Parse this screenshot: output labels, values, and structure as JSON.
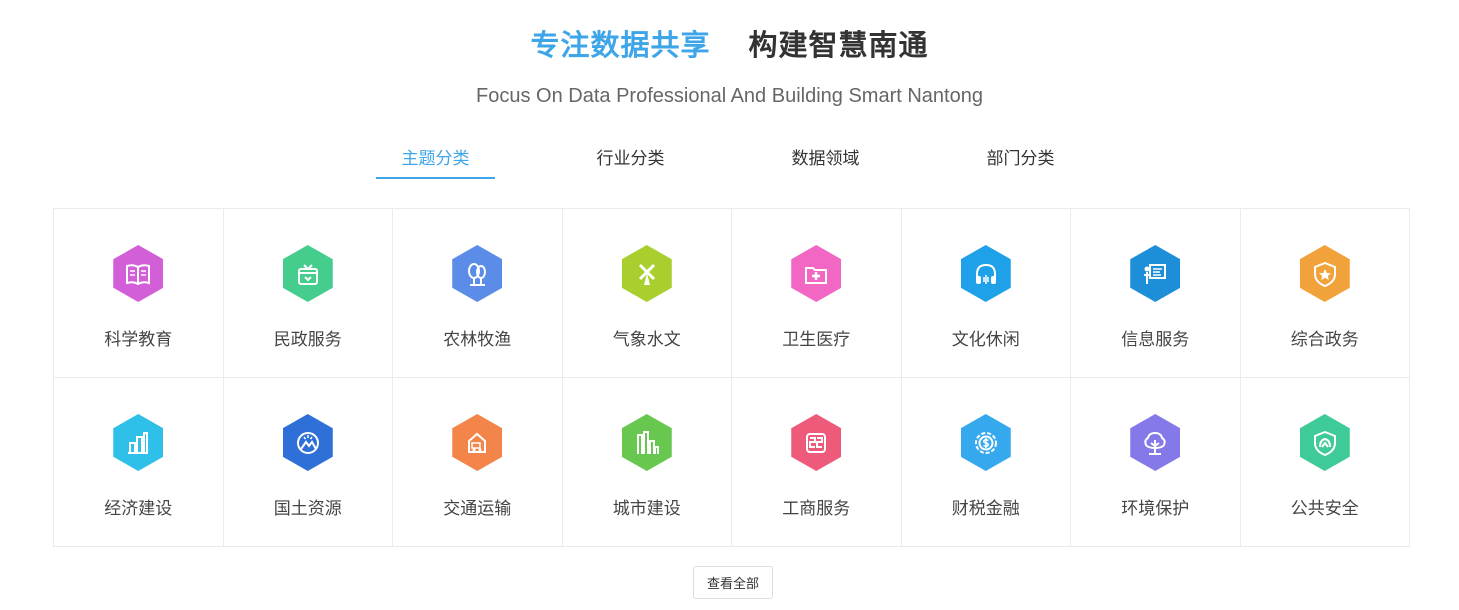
{
  "header": {
    "title_part1": "专注数据共享",
    "title_part2": "构建智慧南通",
    "subtitle": "Focus On Data Professional And Building Smart Nantong"
  },
  "tabs": [
    {
      "label": "主题分类",
      "active": true
    },
    {
      "label": "行业分类",
      "active": false
    },
    {
      "label": "数据领域",
      "active": false
    },
    {
      "label": "部门分类",
      "active": false
    }
  ],
  "categories": [
    {
      "label": "科学教育",
      "icon": "book-icon",
      "color": "#d35fd8"
    },
    {
      "label": "民政服务",
      "icon": "gift-box-icon",
      "color": "#45cd8e"
    },
    {
      "label": "农林牧渔",
      "icon": "tree-icon",
      "color": "#5b8ce8"
    },
    {
      "label": "气象水文",
      "icon": "windmill-icon",
      "color": "#a8cf2e"
    },
    {
      "label": "卫生医疗",
      "icon": "medical-folder-icon",
      "color": "#f167c3"
    },
    {
      "label": "文化休闲",
      "icon": "headphones-icon",
      "color": "#1ea1e8"
    },
    {
      "label": "信息服务",
      "icon": "presentation-icon",
      "color": "#1c8fd8"
    },
    {
      "label": "综合政务",
      "icon": "shield-star-icon",
      "color": "#f2a23a"
    },
    {
      "label": "经济建设",
      "icon": "building-chart-icon",
      "color": "#2ec0e8"
    },
    {
      "label": "国土资源",
      "icon": "mountain-sun-icon",
      "color": "#2f70d8"
    },
    {
      "label": "交通运输",
      "icon": "truck-box-icon",
      "color": "#f3854a"
    },
    {
      "label": "城市建设",
      "icon": "city-buildings-icon",
      "color": "#67c74e"
    },
    {
      "label": "工商服务",
      "icon": "business-seal-icon",
      "color": "#ee5a7a"
    },
    {
      "label": "财税金融",
      "icon": "coin-gear-icon",
      "color": "#35a8ee"
    },
    {
      "label": "环境保护",
      "icon": "tree-environment-icon",
      "color": "#8578e8"
    },
    {
      "label": "公共安全",
      "icon": "safety-shield-icon",
      "color": "#3fcb98"
    }
  ],
  "view_all_label": "查看全部"
}
